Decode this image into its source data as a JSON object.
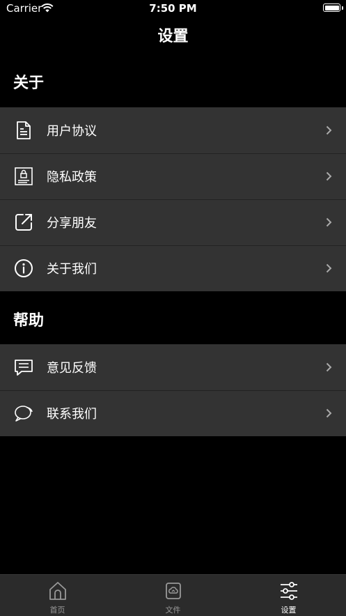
{
  "status_bar": {
    "carrier": "Carrier",
    "time": "7:50 PM"
  },
  "nav": {
    "title": "设置"
  },
  "sections": [
    {
      "header": "关于",
      "items": [
        {
          "label": "用户协议",
          "icon": "document-icon"
        },
        {
          "label": "隐私政策",
          "icon": "privacy-lock-icon"
        },
        {
          "label": "分享朋友",
          "icon": "share-icon"
        },
        {
          "label": "关于我们",
          "icon": "info-icon"
        }
      ]
    },
    {
      "header": "帮助",
      "items": [
        {
          "label": "意见反馈",
          "icon": "feedback-message-icon"
        },
        {
          "label": "联系我们",
          "icon": "chat-bubbles-icon"
        }
      ]
    }
  ],
  "tab_bar": {
    "tabs": [
      {
        "label": "首页",
        "icon": "home-icon",
        "active": false
      },
      {
        "label": "文件",
        "icon": "file-cloud-icon",
        "active": false
      },
      {
        "label": "设置",
        "icon": "sliders-icon",
        "active": true
      }
    ]
  },
  "colors": {
    "background": "#000000",
    "cell": "#333333",
    "tab_bar": "#2b2b2b",
    "tab_inactive": "#999999"
  }
}
